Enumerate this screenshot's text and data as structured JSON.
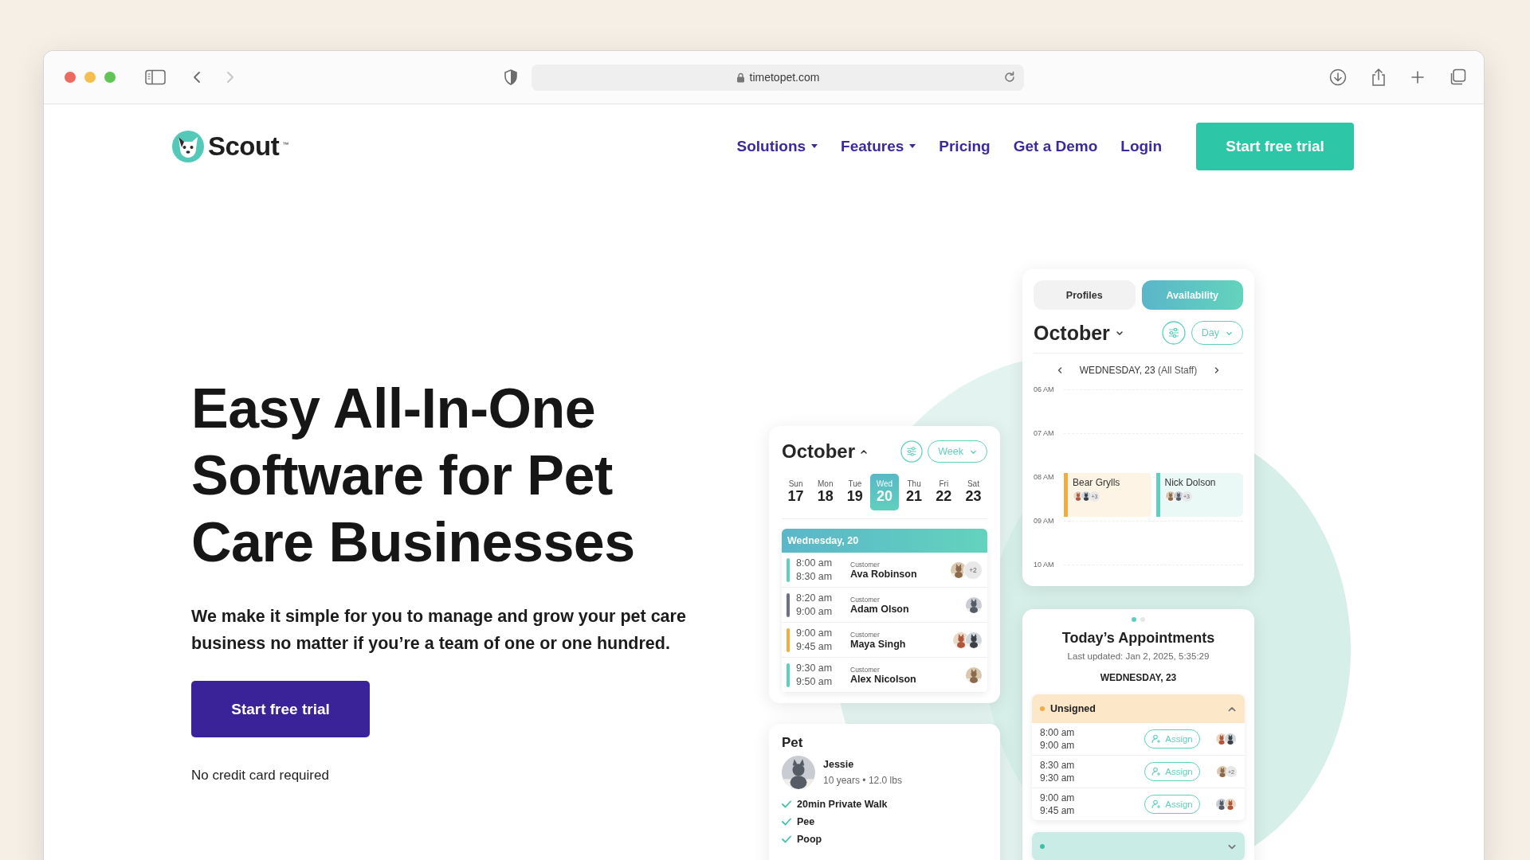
{
  "browser": {
    "url": "timetopet.com",
    "nav_buttons": [
      {
        "kind": "back",
        "disabled": false
      },
      {
        "kind": "forward",
        "disabled": true
      }
    ]
  },
  "nav": {
    "logo": "Scout",
    "logo_mark": "™",
    "items": [
      {
        "label": "Solutions",
        "dropdown": true
      },
      {
        "label": "Features",
        "dropdown": true
      },
      {
        "label": "Pricing",
        "dropdown": false
      },
      {
        "label": "Get a Demo",
        "dropdown": false
      },
      {
        "label": "Login",
        "dropdown": false
      }
    ],
    "cta": "Start free trial"
  },
  "hero": {
    "title": "Easy All-In-One Software for Pet Care Businesses",
    "subtitle": "We make it simple for you to manage and grow your pet care business no matter if you’re a team of one or one hundred.",
    "cta": "Start free trial",
    "note": "No credit card required"
  },
  "week_card": {
    "month": "October",
    "view": "Week",
    "days": [
      {
        "weekday": "Sun",
        "date": "17",
        "selected": false
      },
      {
        "weekday": "Mon",
        "date": "18",
        "selected": false
      },
      {
        "weekday": "Tue",
        "date": "19",
        "selected": false
      },
      {
        "weekday": "Wed",
        "date": "20",
        "selected": true
      },
      {
        "weekday": "Thu",
        "date": "21",
        "selected": false
      },
      {
        "weekday": "Fri",
        "date": "22",
        "selected": false
      },
      {
        "weekday": "Sat",
        "date": "23",
        "selected": false
      }
    ],
    "agenda_header": "Wednesday, 20",
    "appointments": [
      {
        "start": "8:00 am",
        "end": "8:30 am",
        "label": "Customer",
        "name": "Ava Robinson",
        "color": "#5fd0bd",
        "more": "+2"
      },
      {
        "start": "8:20 am",
        "end": "9:00 am",
        "label": "Customer",
        "name": "Adam Olson",
        "color": "#6b7288"
      },
      {
        "start": "9:00 am",
        "end": "9:45 am",
        "label": "Customer",
        "name": "Maya Singh",
        "color": "#f5ab3e"
      },
      {
        "start": "9:30 am",
        "end": "9:50 am",
        "label": "Customer",
        "name": "Alex Nicolson",
        "color": "#5fd0bd"
      }
    ]
  },
  "pet_card": {
    "title": "Pet",
    "name": "Jessie",
    "details": "10 years • 12.0 lbs",
    "tasks": [
      {
        "label": "20min Private Walk",
        "done": true
      },
      {
        "label": "Pee",
        "done": true
      },
      {
        "label": "Poop",
        "done": true
      }
    ]
  },
  "availability_card": {
    "tabs": [
      {
        "label": "Profiles",
        "selected": false
      },
      {
        "label": "Availability",
        "selected": true
      }
    ],
    "month": "October",
    "view": "Day",
    "date_label": "WEDNESDAY, 23",
    "date_note": "(All Staff)",
    "hours": [
      {
        "label": "06 AM"
      },
      {
        "label": "07 AM"
      },
      {
        "label": "08 AM",
        "blocks": [
          {
            "name": "Bear Grylls",
            "color": "#f5ab3e",
            "more": "+3"
          },
          {
            "name": "Nick Dolson",
            "color": "#5fd0bd",
            "more": "+3"
          }
        ]
      },
      {
        "label": "09 AM"
      },
      {
        "label": "10 AM"
      }
    ]
  },
  "appointments_card": {
    "pager": [
      {
        "selected": true
      },
      {
        "selected": false
      }
    ],
    "title": "Today’s Appointments",
    "updated": "Last updated: Jan 2, 2025, 5:35:29",
    "date": "WEDNESDAY, 23",
    "groups": [
      {
        "label": "Unsigned",
        "color": "#f5ab3e",
        "expanded": true,
        "rows": [
          {
            "start": "8:00 am",
            "end": "9:00 am",
            "action": "Assign"
          },
          {
            "start": "8:30 am",
            "end": "9:30 am",
            "action": "Assign",
            "more": "+2"
          },
          {
            "start": "9:00 am",
            "end": "9:45 am",
            "action": "Assign"
          }
        ]
      },
      {
        "color": "#3fbfa6",
        "expanded": false
      }
    ]
  }
}
